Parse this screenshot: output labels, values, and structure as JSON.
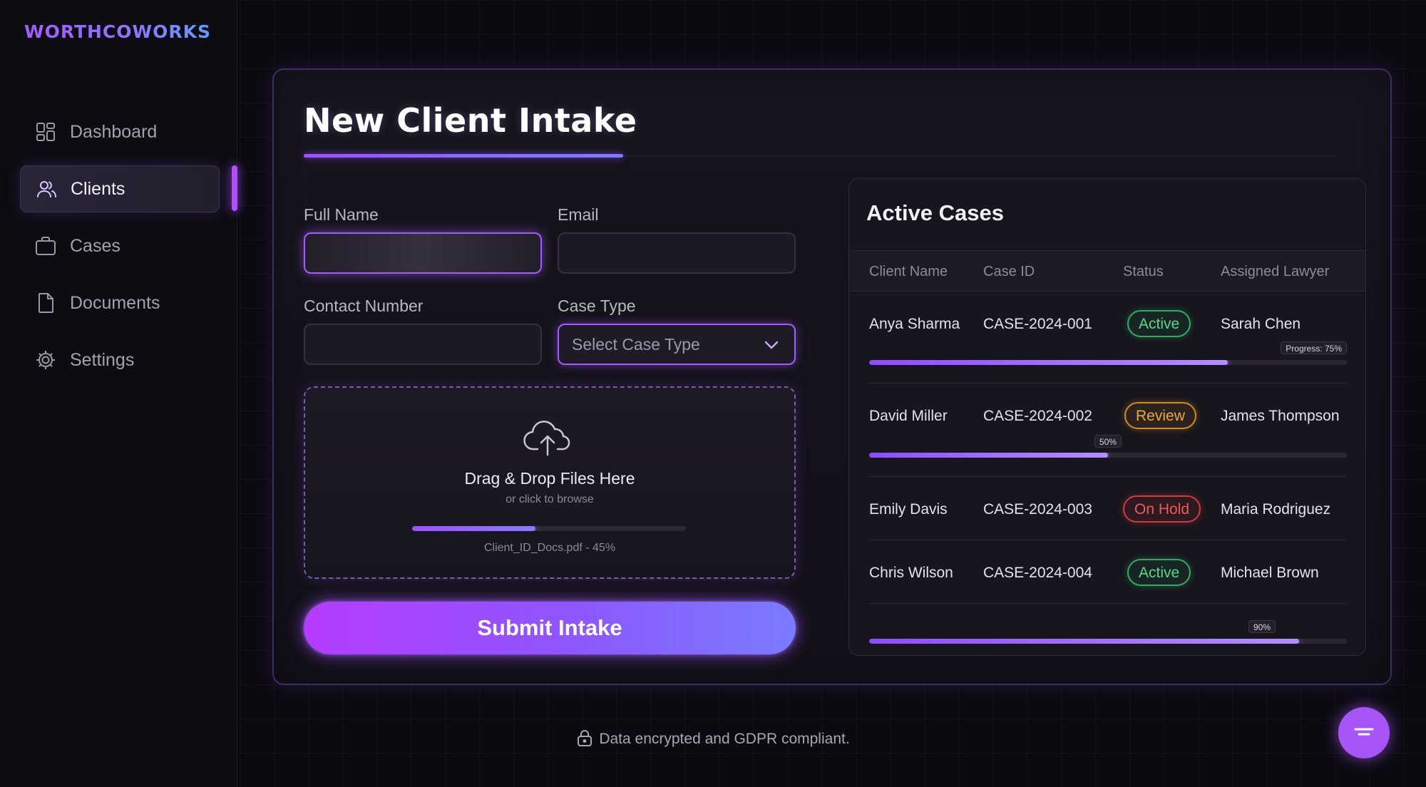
{
  "brand": "WORTHCOWORKS",
  "sidebar": {
    "items": [
      {
        "label": "Dashboard",
        "icon": "dashboard-grid-icon",
        "active": false
      },
      {
        "label": "Clients",
        "icon": "users-icon",
        "active": true
      },
      {
        "label": "Cases",
        "icon": "briefcase-icon",
        "active": false
      },
      {
        "label": "Documents",
        "icon": "document-icon",
        "active": false
      },
      {
        "label": "Settings",
        "icon": "gear-icon",
        "active": false
      }
    ]
  },
  "form": {
    "title": "New Client Intake",
    "full_name_label": "Full Name",
    "full_name_value": "",
    "email_label": "Email",
    "email_value": "",
    "contact_label": "Contact Number",
    "contact_value": "",
    "case_type_label": "Case Type",
    "case_type_placeholder": "Select Case Type",
    "upload": {
      "title": "Drag & Drop Files Here",
      "subtitle": "or click to browse",
      "progress": 0.45,
      "file_status": "Client_ID_Docs.pdf - 45%"
    },
    "submit_label": "Submit Intake"
  },
  "cases": {
    "title": "Active Cases",
    "columns": [
      "Client Name",
      "Case ID",
      "Status",
      "Assigned Lawyer"
    ],
    "rows": [
      {
        "client": "Anya Sharma",
        "case_id": "CASE-2024-001",
        "status": "Active",
        "status_kind": "active",
        "lawyer": "Sarah Chen",
        "progress": 0.75,
        "progress_label": "Progress: 75%"
      },
      {
        "client": "David Miller",
        "case_id": "CASE-2024-002",
        "status": "Review",
        "status_kind": "review",
        "lawyer": "James Thompson",
        "progress": 0.5,
        "progress_label": "50%"
      },
      {
        "client": "Emily Davis",
        "case_id": "CASE-2024-003",
        "status": "On Hold",
        "status_kind": "hold",
        "lawyer": "Maria Rodriguez",
        "progress": null,
        "progress_label": ""
      },
      {
        "client": "Chris Wilson",
        "case_id": "CASE-2024-004",
        "status": "Active",
        "status_kind": "active",
        "lawyer": "Michael Brown",
        "progress": 0.9,
        "progress_label": "90%"
      }
    ]
  },
  "footer": {
    "security_note": "Data encrypted and GDPR compliant."
  },
  "colors": {
    "accent": "#a855f7",
    "active_status": "#2fae62",
    "review_status": "#d08a26",
    "hold_status": "#cf3c3c"
  }
}
